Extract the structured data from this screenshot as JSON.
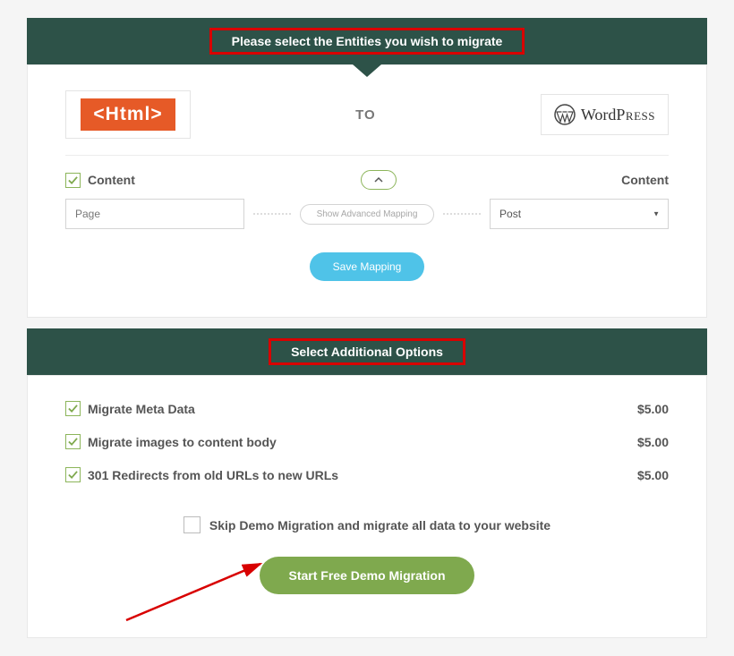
{
  "entities": {
    "header": "Please select the Entities you wish to migrate",
    "source_logo_text": "<Html>",
    "to_label": "TO",
    "target_logo_word": "Word",
    "target_logo_press": "Press",
    "source_label": "Content",
    "target_label": "Content",
    "source_value": "Page",
    "adv_mapping_label": "Show Advanced Mapping",
    "target_value": "Post",
    "save_btn": "Save Mapping"
  },
  "options": {
    "header": "Select Additional Options",
    "items": [
      {
        "label": "Migrate Meta Data",
        "price": "$5.00"
      },
      {
        "label": "Migrate images to content body",
        "price": "$5.00"
      },
      {
        "label": "301 Redirects from old URLs to new URLs",
        "price": "$5.00"
      }
    ],
    "skip_label": "Skip Demo Migration and migrate all data to your website",
    "start_btn": "Start Free Demo Migration"
  }
}
